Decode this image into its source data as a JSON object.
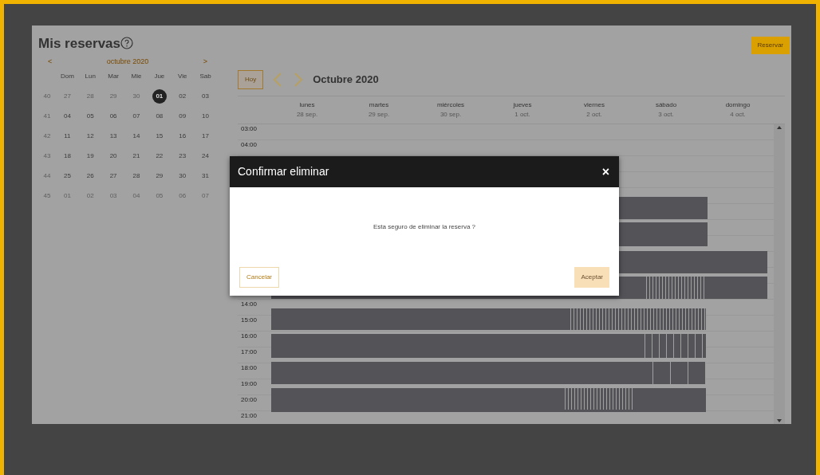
{
  "page": {
    "title": "Mis reservas",
    "reserve_button": "Reservar"
  },
  "mini_calendar": {
    "month": "octubre 2020",
    "prev": "<",
    "next": ">",
    "weekdays": [
      "Dom",
      "Lun",
      "Mar",
      "Mie",
      "Jue",
      "Vie",
      "Sab"
    ],
    "weeks": [
      {
        "number": "40",
        "days": [
          {
            "day": "27",
            "muted": true,
            "selected": false
          },
          {
            "day": "28",
            "muted": true,
            "selected": false
          },
          {
            "day": "29",
            "muted": true,
            "selected": false
          },
          {
            "day": "30",
            "muted": true,
            "selected": false
          },
          {
            "day": "01",
            "muted": false,
            "selected": true
          },
          {
            "day": "02",
            "muted": false,
            "selected": false
          },
          {
            "day": "03",
            "muted": false,
            "selected": false
          }
        ]
      },
      {
        "number": "41",
        "days": [
          {
            "day": "04",
            "muted": false,
            "selected": false
          },
          {
            "day": "05",
            "muted": false,
            "selected": false
          },
          {
            "day": "06",
            "muted": false,
            "selected": false
          },
          {
            "day": "07",
            "muted": false,
            "selected": false
          },
          {
            "day": "08",
            "muted": false,
            "selected": false
          },
          {
            "day": "09",
            "muted": false,
            "selected": false
          },
          {
            "day": "10",
            "muted": false,
            "selected": false
          }
        ]
      },
      {
        "number": "42",
        "days": [
          {
            "day": "11",
            "muted": false,
            "selected": false
          },
          {
            "day": "12",
            "muted": false,
            "selected": false
          },
          {
            "day": "13",
            "muted": false,
            "selected": false
          },
          {
            "day": "14",
            "muted": false,
            "selected": false
          },
          {
            "day": "15",
            "muted": false,
            "selected": false
          },
          {
            "day": "16",
            "muted": false,
            "selected": false
          },
          {
            "day": "17",
            "muted": false,
            "selected": false
          }
        ]
      },
      {
        "number": "43",
        "days": [
          {
            "day": "18",
            "muted": false,
            "selected": false
          },
          {
            "day": "19",
            "muted": false,
            "selected": false
          },
          {
            "day": "20",
            "muted": false,
            "selected": false
          },
          {
            "day": "21",
            "muted": false,
            "selected": false
          },
          {
            "day": "22",
            "muted": false,
            "selected": false
          },
          {
            "day": "23",
            "muted": false,
            "selected": false
          },
          {
            "day": "24",
            "muted": false,
            "selected": false
          }
        ]
      },
      {
        "number": "44",
        "days": [
          {
            "day": "25",
            "muted": false,
            "selected": false
          },
          {
            "day": "26",
            "muted": false,
            "selected": false
          },
          {
            "day": "27",
            "muted": false,
            "selected": false
          },
          {
            "day": "28",
            "muted": false,
            "selected": false
          },
          {
            "day": "29",
            "muted": false,
            "selected": false
          },
          {
            "day": "30",
            "muted": false,
            "selected": false
          },
          {
            "day": "31",
            "muted": false,
            "selected": false
          }
        ]
      },
      {
        "number": "45",
        "days": [
          {
            "day": "01",
            "muted": true,
            "selected": false
          },
          {
            "day": "02",
            "muted": true,
            "selected": false
          },
          {
            "day": "03",
            "muted": true,
            "selected": false
          },
          {
            "day": "04",
            "muted": true,
            "selected": false
          },
          {
            "day": "05",
            "muted": true,
            "selected": false
          },
          {
            "day": "06",
            "muted": true,
            "selected": false
          },
          {
            "day": "07",
            "muted": true,
            "selected": false
          }
        ]
      }
    ]
  },
  "week_view": {
    "today_button": "Hoy",
    "title": "Octubre 2020",
    "days": [
      {
        "name": "lunes",
        "date": "28 sep."
      },
      {
        "name": "martes",
        "date": "29 sep."
      },
      {
        "name": "miércoles",
        "date": "30 sep."
      },
      {
        "name": "jueves",
        "date": "1 oct."
      },
      {
        "name": "viernes",
        "date": "2 oct."
      },
      {
        "name": "sábado",
        "date": "3 oct."
      },
      {
        "name": "domingo",
        "date": "4 oct."
      }
    ],
    "hours_above_dialog": [
      "03:00",
      "04:00"
    ],
    "hours_below_dialog": [
      "14:00",
      "15:00",
      "16:00",
      "17:00",
      "18:00",
      "19:00",
      "20:00",
      "21:00"
    ]
  },
  "modal": {
    "title": "Confirmar eliminar",
    "close": "×",
    "message": "Esta seguro de eliminar la reserva ?",
    "cancel": "Cancelar",
    "accept": "Aceptar"
  }
}
